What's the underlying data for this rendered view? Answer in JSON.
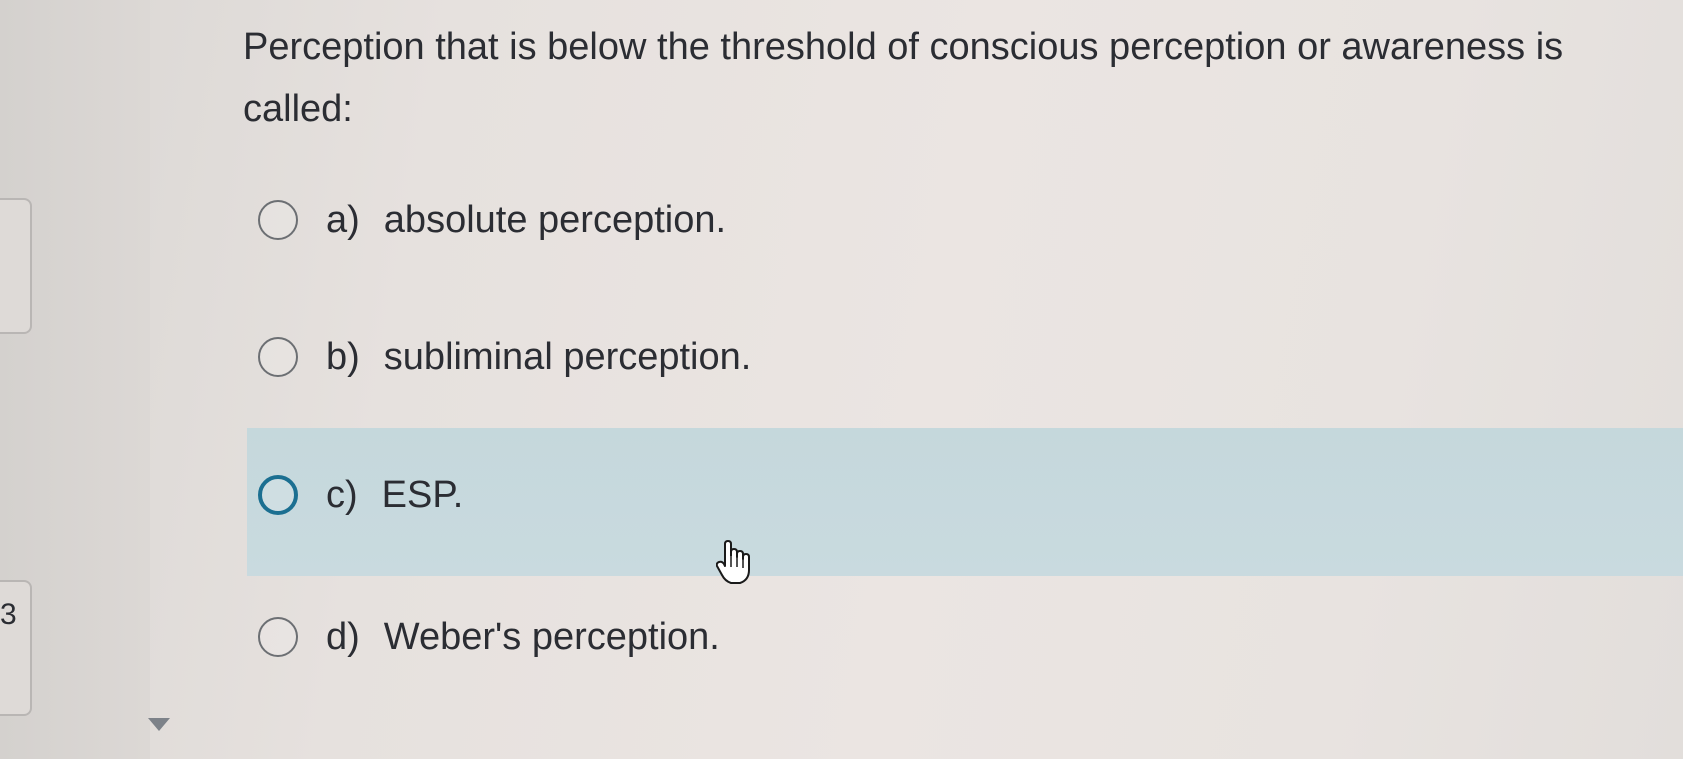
{
  "question": {
    "text": "Perception that is below the threshold of conscious perception or awareness is called:"
  },
  "options": [
    {
      "letter": "a)",
      "text": "absolute perception."
    },
    {
      "letter": "b)",
      "text": "subliminal perception."
    },
    {
      "letter": "c)",
      "text": "ESP."
    },
    {
      "letter": "d)",
      "text": "Weber's perception."
    }
  ],
  "hovered_option": "c)",
  "side_panel": {
    "partial_number": "3"
  },
  "icons": {
    "cursor": "hand-pointer-icon",
    "scroll": "down-arrow-icon"
  },
  "colors": {
    "highlight": "#c7d9dd",
    "active_radio": "#1b6f91",
    "text": "#2b2d33"
  }
}
